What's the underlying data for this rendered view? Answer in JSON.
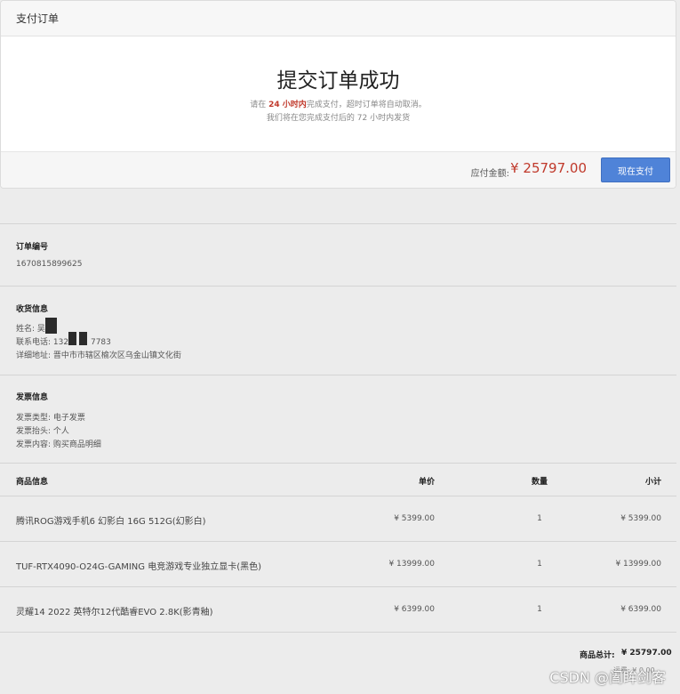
{
  "header": {
    "title": "支付订单"
  },
  "success": {
    "title": "提交订单成功",
    "tip_prefix": "请在",
    "tip_hours": "24 小时内",
    "tip_suffix": "完成支付，超时订单将自动取消。",
    "tip_line2": "我们将在您完成支付后的 72 小时内发货"
  },
  "payment": {
    "amount_label": "应付金额:",
    "amount": "¥ 25797.00",
    "pay_button": "现在支付"
  },
  "order": {
    "title": "订单编号",
    "number": "1670815899625"
  },
  "shipping": {
    "title": "收货信息",
    "name_label": "姓名:",
    "name_value": "吴 岳",
    "phone_label": "联系电话:",
    "phone_value": "132",
    "phone_tail": "7783",
    "address_label": "详细地址:",
    "address_value": "晋中市市辖区榆次区乌金山镇文化街"
  },
  "invoice": {
    "title": "发票信息",
    "type_label": "发票类型:",
    "type_value": "电子发票",
    "header_label": "发票抬头:",
    "header_value": "个人",
    "content_label": "发票内容:",
    "content_value": "购买商品明细"
  },
  "table": {
    "headers": {
      "product": "商品信息",
      "price": "单价",
      "qty": "数量",
      "subtotal": "小计"
    },
    "rows": [
      {
        "name": "腾讯ROG游戏手机6 幻影白 16G 512G(幻影白)",
        "price": "¥ 5399.00",
        "qty": "1",
        "subtotal": "¥ 5399.00"
      },
      {
        "name": "TUF-RTX4090-O24G-GAMING 电竞游戏专业独立显卡(黑色)",
        "price": "¥ 13999.00",
        "qty": "1",
        "subtotal": "¥ 13999.00"
      },
      {
        "name": "灵耀14 2022 英特尔12代酷睿EVO 2.8K(影青釉)",
        "price": "¥ 6399.00",
        "qty": "1",
        "subtotal": "¥ 6399.00"
      }
    ]
  },
  "totals": {
    "label": "商品总计:",
    "value": "¥ 25797.00",
    "fee": "运费: ¥ 0.00"
  },
  "watermark": "CSDN @阖眸剑客"
}
